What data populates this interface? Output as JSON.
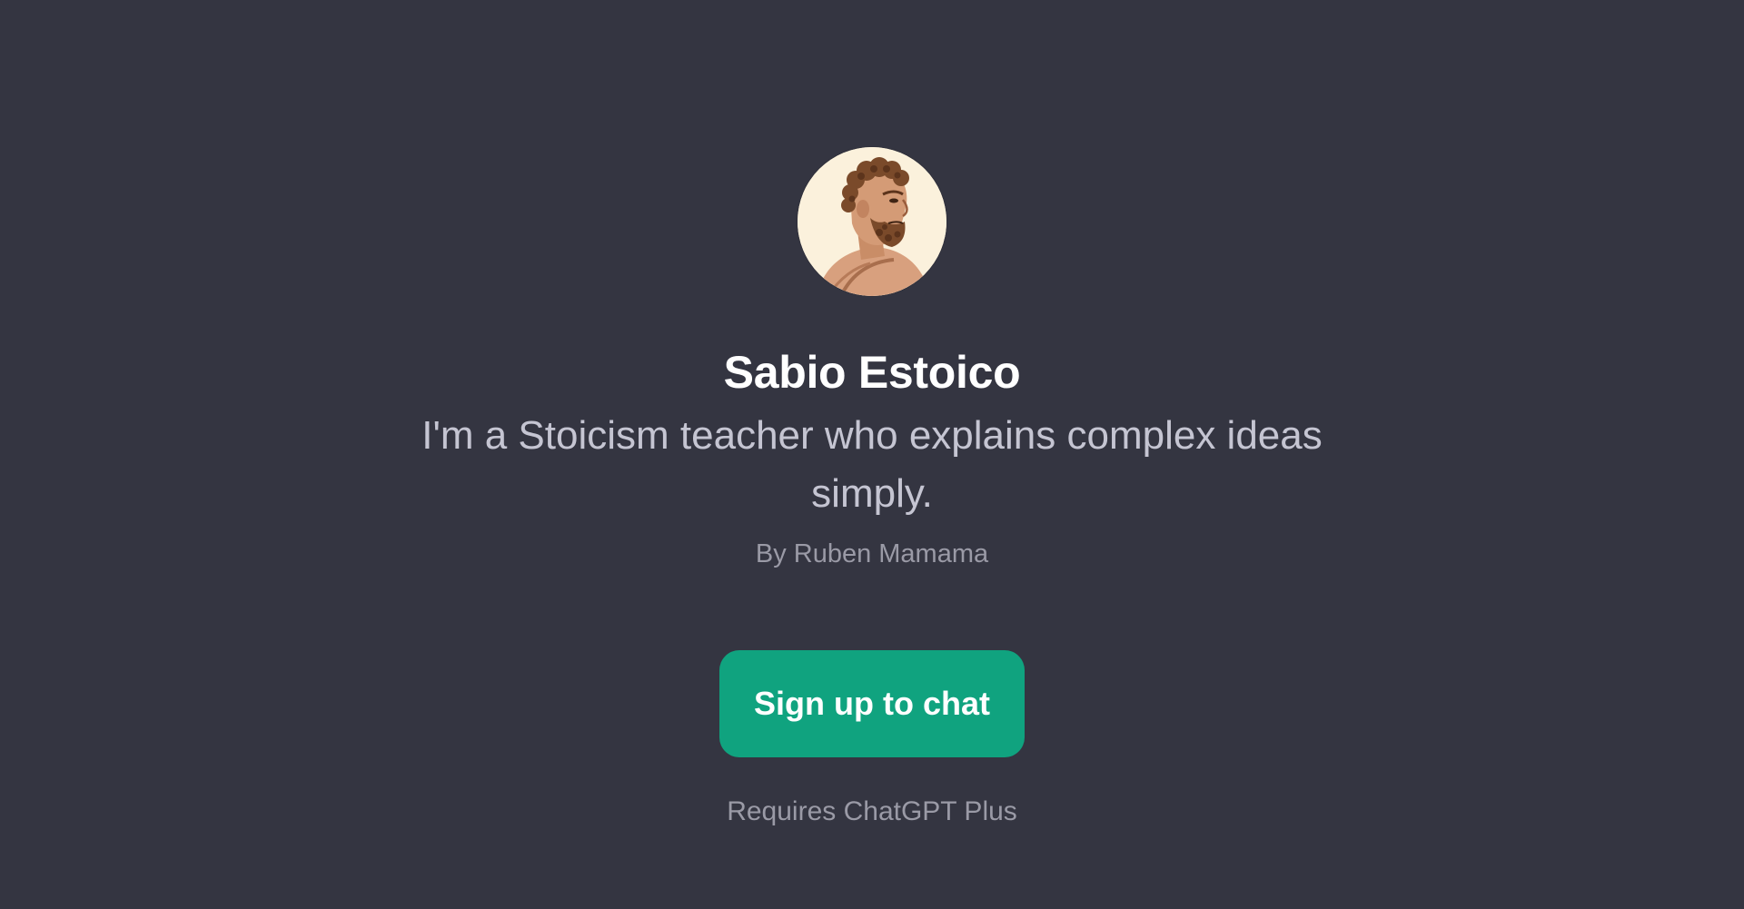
{
  "gpt": {
    "name": "Sabio Estoico",
    "description": "I'm a Stoicism teacher who explains complex ideas simply.",
    "author": "By Ruben Mamama",
    "avatar_icon": "stoic-philosopher-bust-icon"
  },
  "actions": {
    "signup_label": "Sign up to chat",
    "requirement_text": "Requires ChatGPT Plus"
  },
  "colors": {
    "background": "#343541",
    "primary_button": "#10a37f",
    "title_text": "#ffffff",
    "description_text": "#c5c5d2",
    "muted_text": "#9a9aa6",
    "avatar_background": "#fbf1dc"
  }
}
